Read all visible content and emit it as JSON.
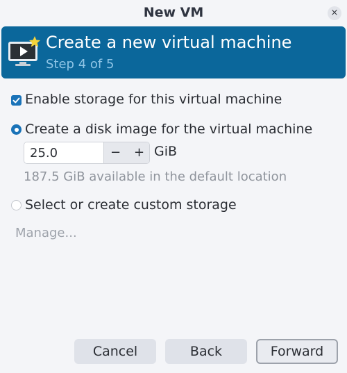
{
  "window": {
    "title": "New VM",
    "close_glyph": "×"
  },
  "header": {
    "title": "Create a new virtual machine",
    "step": "Step 4 of 5",
    "icon": "new-vm-icon",
    "background": "#0b679b"
  },
  "storage": {
    "enable_label": "Enable storage for this virtual machine",
    "enable_checked": true,
    "create_disk_label": "Create a disk image for the virtual machine",
    "create_disk_selected": true,
    "size_value": "25.0",
    "decrement_label": "−",
    "increment_label": "+",
    "unit": "GiB",
    "available_text": "187.5 GiB available in the default location",
    "custom_label": "Select or create custom storage",
    "custom_selected": false,
    "manage_label": "Manage..."
  },
  "buttons": {
    "cancel": "Cancel",
    "back": "Back",
    "forward": "Forward"
  },
  "colors": {
    "accent": "#1a73b8",
    "hint_text": "#8f949c"
  }
}
